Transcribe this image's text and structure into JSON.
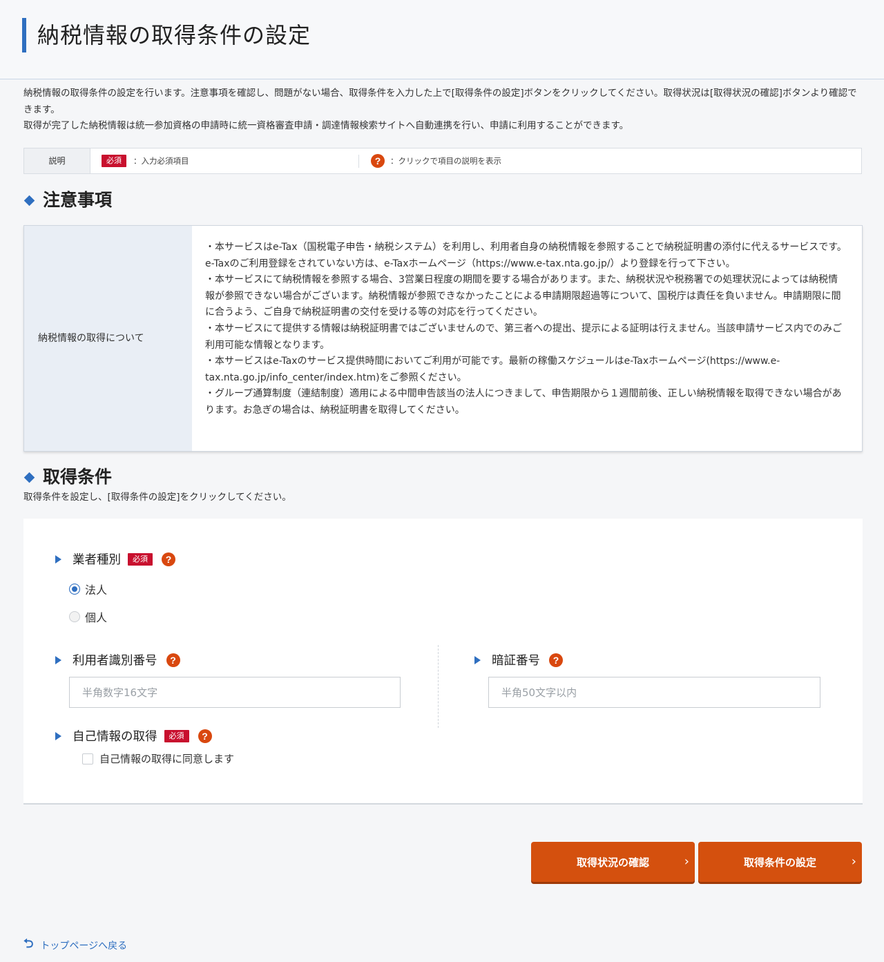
{
  "page": {
    "title": "納税情報の取得条件の設定",
    "intro_line1": "納税情報の取得条件の設定を行います。注意事項を確認し、問題がない場合、取得条件を入力した上で[取得条件の設定]ボタンをクリックしてください。取得状況は[取得状況の確認]ボタンより確認できます。",
    "intro_line2": "取得が完了した納税情報は統一参加資格の申請時に統一資格審査申請・調達情報検索サイトへ自動連携を行い、申請に利用することができます。"
  },
  "legend": {
    "label": "説明",
    "required_badge": "必須",
    "required_text": "：入力必須項目",
    "help_icon_glyph": "?",
    "help_text": "：クリックで項目の説明を表示"
  },
  "notice": {
    "heading": "注意事項",
    "row_label": "納税情報の取得について",
    "items": [
      "・本サービスはe-Tax（国税電子申告・納税システム）を利用し、利用者自身の納税情報を参照することで納税証明書の添付に代えるサービスです。e-Taxのご利用登録をされていない方は、e-Taxホームページ（https://www.e-tax.nta.go.jp/）より登録を行って下さい。",
      "・本サービスにて納税情報を参照する場合、3営業日程度の期間を要する場合があります。また、納税状況や税務署での処理状況によっては納税情報が参照できない場合がございます。納税情報が参照できなかったことによる申請期限超過等について、国税庁は責任を負いません。申請期限に間に合うよう、ご自身で納税証明書の交付を受ける等の対応を行ってください。",
      "・本サービスにて提供する情報は納税証明書ではございませんので、第三者への提出、提示による証明は行えません。当該申請サービス内でのみご利用可能な情報となります。",
      "・本サービスはe-Taxのサービス提供時間においてご利用が可能です。最新の稼働スケジュールはe-Taxホームページ(https://www.e-tax.nta.go.jp/info_center/index.htm)をご参照ください。",
      "・グループ通算制度（連結制度）適用による中間申告該当の法人につきまして、申告期限から１週間前後、正しい納税情報を取得できない場合があります。お急ぎの場合は、納税証明書を取得してください。"
    ]
  },
  "conditions": {
    "heading": "取得条件",
    "description": "取得条件を設定し、[取得条件の設定]をクリックしてください。",
    "business_type": {
      "label": "業者種別",
      "required_badge": "必須",
      "options": [
        "法人",
        "個人"
      ],
      "selected": "法人"
    },
    "user_id": {
      "label": "利用者識別番号",
      "placeholder": "半角数字16文字",
      "value": ""
    },
    "pin": {
      "label": "暗証番号",
      "placeholder": "半角50文字以内",
      "value": ""
    },
    "self_info": {
      "label": "自己情報の取得",
      "required_badge": "必須",
      "checkbox_label": "自己情報の取得に同意します",
      "checked": false
    }
  },
  "buttons": {
    "check_status": "取得状況の確認",
    "set_conditions": "取得条件の設定",
    "chevron": "›"
  },
  "footer": {
    "back_icon": "⮌",
    "back_link": "トップページへ戻る"
  },
  "colors": {
    "accent_blue": "#2f6fc0",
    "required_red": "#c8102e",
    "help_orange": "#d9480f",
    "button_orange": "#d4500e"
  }
}
